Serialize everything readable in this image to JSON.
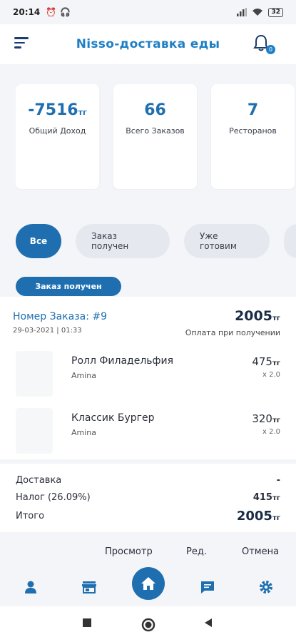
{
  "status_bar": {
    "time": "20:14",
    "battery": "32",
    "icons": [
      "alarm-icon",
      "headphones-icon",
      "signal-icon",
      "wifi-icon",
      "battery-icon"
    ]
  },
  "app_bar": {
    "title": "Nisso-доставка еды",
    "notification_count": "0"
  },
  "stats": [
    {
      "value": "-7516",
      "unit": "тг",
      "label": "Общий Доход"
    },
    {
      "value": "66",
      "unit": "",
      "label": "Всего Заказов"
    },
    {
      "value": "7",
      "unit": "",
      "label": "Ресторанов"
    }
  ],
  "filters": [
    {
      "label": "Все",
      "active": true
    },
    {
      "label": "Заказ получен",
      "active": false
    },
    {
      "label": "Уже готовим",
      "active": false
    }
  ],
  "order": {
    "status": "Заказ получен",
    "number": "Номер Заказа: #9",
    "date": "29-03-2021 | 01:33",
    "total": "2005",
    "currency": "тг",
    "payment": "Оплата при получении",
    "items": [
      {
        "name": "Ролл Филадельфия",
        "restaurant": "Amina",
        "price": "475",
        "qty": "x 2.0"
      },
      {
        "name": "Классик Бургер",
        "restaurant": "Amina",
        "price": "320",
        "qty": "x 2.0"
      }
    ],
    "summary": {
      "delivery_label": "Доставка",
      "delivery_value": "-",
      "tax_label": "Налог (26.09%)",
      "tax_value": "415",
      "total_label": "Итого",
      "total_value": "2005"
    }
  },
  "actions": {
    "view": "Просмотр",
    "edit": "Ред.",
    "cancel": "Отмена"
  },
  "bottom_nav": [
    "profile-icon",
    "store-icon",
    "home-icon",
    "chat-icon",
    "settings-icon"
  ],
  "colors": {
    "primary": "#1f6fb0",
    "title": "#1f7fc4",
    "background": "#f4f5f9",
    "chip": "#e5e8ef"
  }
}
